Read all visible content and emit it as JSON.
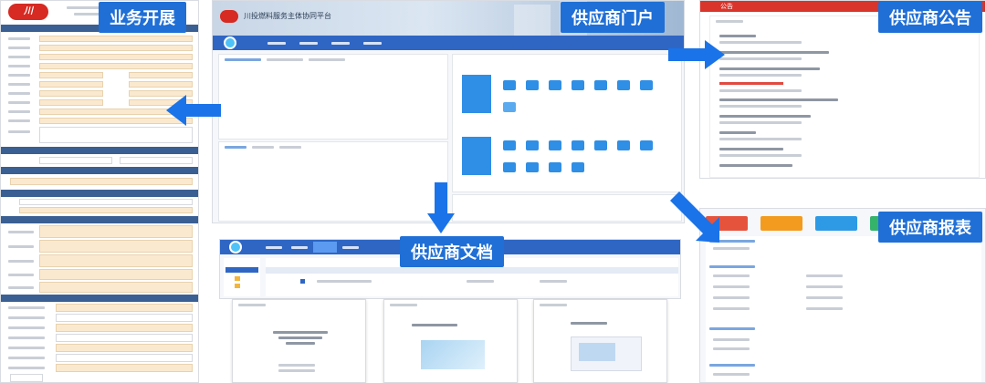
{
  "callouts": {
    "business": "业务开展",
    "portal": "供应商门户",
    "notice": "供应商公告",
    "documents": "供应商文档",
    "reports": "供应商报表"
  },
  "portal": {
    "title": "川投燃料服务主体协同平台"
  },
  "notice_panel": {
    "title": "公告"
  },
  "colors": {
    "callout_bg": "#1f6fd6",
    "arrow": "#1a73e8",
    "nav_blue": "#2f66c4",
    "form_cell": "#fbe9cf",
    "notice_red": "#d9352b"
  }
}
